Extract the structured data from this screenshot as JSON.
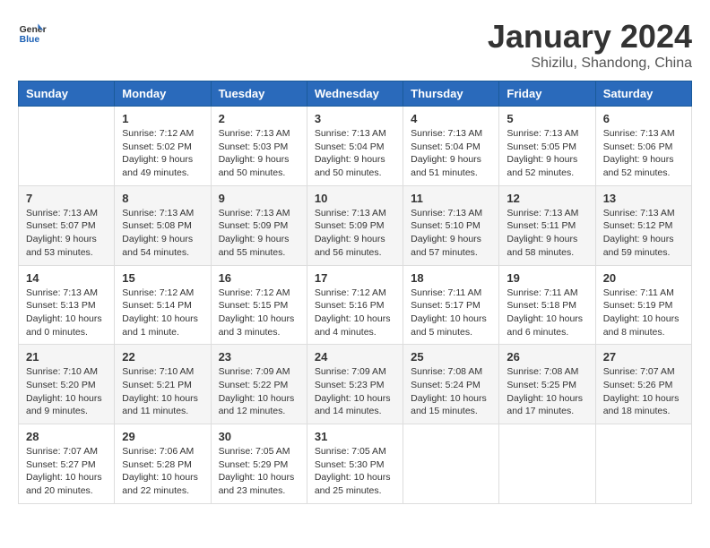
{
  "header": {
    "logo_line1": "General",
    "logo_line2": "Blue",
    "month": "January 2024",
    "location": "Shizilu, Shandong, China"
  },
  "weekdays": [
    "Sunday",
    "Monday",
    "Tuesday",
    "Wednesday",
    "Thursday",
    "Friday",
    "Saturday"
  ],
  "weeks": [
    [
      {
        "day": "",
        "info": ""
      },
      {
        "day": "1",
        "info": "Sunrise: 7:12 AM\nSunset: 5:02 PM\nDaylight: 9 hours\nand 49 minutes."
      },
      {
        "day": "2",
        "info": "Sunrise: 7:13 AM\nSunset: 5:03 PM\nDaylight: 9 hours\nand 50 minutes."
      },
      {
        "day": "3",
        "info": "Sunrise: 7:13 AM\nSunset: 5:04 PM\nDaylight: 9 hours\nand 50 minutes."
      },
      {
        "day": "4",
        "info": "Sunrise: 7:13 AM\nSunset: 5:04 PM\nDaylight: 9 hours\nand 51 minutes."
      },
      {
        "day": "5",
        "info": "Sunrise: 7:13 AM\nSunset: 5:05 PM\nDaylight: 9 hours\nand 52 minutes."
      },
      {
        "day": "6",
        "info": "Sunrise: 7:13 AM\nSunset: 5:06 PM\nDaylight: 9 hours\nand 52 minutes."
      }
    ],
    [
      {
        "day": "7",
        "info": "Sunrise: 7:13 AM\nSunset: 5:07 PM\nDaylight: 9 hours\nand 53 minutes."
      },
      {
        "day": "8",
        "info": "Sunrise: 7:13 AM\nSunset: 5:08 PM\nDaylight: 9 hours\nand 54 minutes."
      },
      {
        "day": "9",
        "info": "Sunrise: 7:13 AM\nSunset: 5:09 PM\nDaylight: 9 hours\nand 55 minutes."
      },
      {
        "day": "10",
        "info": "Sunrise: 7:13 AM\nSunset: 5:09 PM\nDaylight: 9 hours\nand 56 minutes."
      },
      {
        "day": "11",
        "info": "Sunrise: 7:13 AM\nSunset: 5:10 PM\nDaylight: 9 hours\nand 57 minutes."
      },
      {
        "day": "12",
        "info": "Sunrise: 7:13 AM\nSunset: 5:11 PM\nDaylight: 9 hours\nand 58 minutes."
      },
      {
        "day": "13",
        "info": "Sunrise: 7:13 AM\nSunset: 5:12 PM\nDaylight: 9 hours\nand 59 minutes."
      }
    ],
    [
      {
        "day": "14",
        "info": "Sunrise: 7:13 AM\nSunset: 5:13 PM\nDaylight: 10 hours\nand 0 minutes."
      },
      {
        "day": "15",
        "info": "Sunrise: 7:12 AM\nSunset: 5:14 PM\nDaylight: 10 hours\nand 1 minute."
      },
      {
        "day": "16",
        "info": "Sunrise: 7:12 AM\nSunset: 5:15 PM\nDaylight: 10 hours\nand 3 minutes."
      },
      {
        "day": "17",
        "info": "Sunrise: 7:12 AM\nSunset: 5:16 PM\nDaylight: 10 hours\nand 4 minutes."
      },
      {
        "day": "18",
        "info": "Sunrise: 7:11 AM\nSunset: 5:17 PM\nDaylight: 10 hours\nand 5 minutes."
      },
      {
        "day": "19",
        "info": "Sunrise: 7:11 AM\nSunset: 5:18 PM\nDaylight: 10 hours\nand 6 minutes."
      },
      {
        "day": "20",
        "info": "Sunrise: 7:11 AM\nSunset: 5:19 PM\nDaylight: 10 hours\nand 8 minutes."
      }
    ],
    [
      {
        "day": "21",
        "info": "Sunrise: 7:10 AM\nSunset: 5:20 PM\nDaylight: 10 hours\nand 9 minutes."
      },
      {
        "day": "22",
        "info": "Sunrise: 7:10 AM\nSunset: 5:21 PM\nDaylight: 10 hours\nand 11 minutes."
      },
      {
        "day": "23",
        "info": "Sunrise: 7:09 AM\nSunset: 5:22 PM\nDaylight: 10 hours\nand 12 minutes."
      },
      {
        "day": "24",
        "info": "Sunrise: 7:09 AM\nSunset: 5:23 PM\nDaylight: 10 hours\nand 14 minutes."
      },
      {
        "day": "25",
        "info": "Sunrise: 7:08 AM\nSunset: 5:24 PM\nDaylight: 10 hours\nand 15 minutes."
      },
      {
        "day": "26",
        "info": "Sunrise: 7:08 AM\nSunset: 5:25 PM\nDaylight: 10 hours\nand 17 minutes."
      },
      {
        "day": "27",
        "info": "Sunrise: 7:07 AM\nSunset: 5:26 PM\nDaylight: 10 hours\nand 18 minutes."
      }
    ],
    [
      {
        "day": "28",
        "info": "Sunrise: 7:07 AM\nSunset: 5:27 PM\nDaylight: 10 hours\nand 20 minutes."
      },
      {
        "day": "29",
        "info": "Sunrise: 7:06 AM\nSunset: 5:28 PM\nDaylight: 10 hours\nand 22 minutes."
      },
      {
        "day": "30",
        "info": "Sunrise: 7:05 AM\nSunset: 5:29 PM\nDaylight: 10 hours\nand 23 minutes."
      },
      {
        "day": "31",
        "info": "Sunrise: 7:05 AM\nSunset: 5:30 PM\nDaylight: 10 hours\nand 25 minutes."
      },
      {
        "day": "",
        "info": ""
      },
      {
        "day": "",
        "info": ""
      },
      {
        "day": "",
        "info": ""
      }
    ]
  ]
}
